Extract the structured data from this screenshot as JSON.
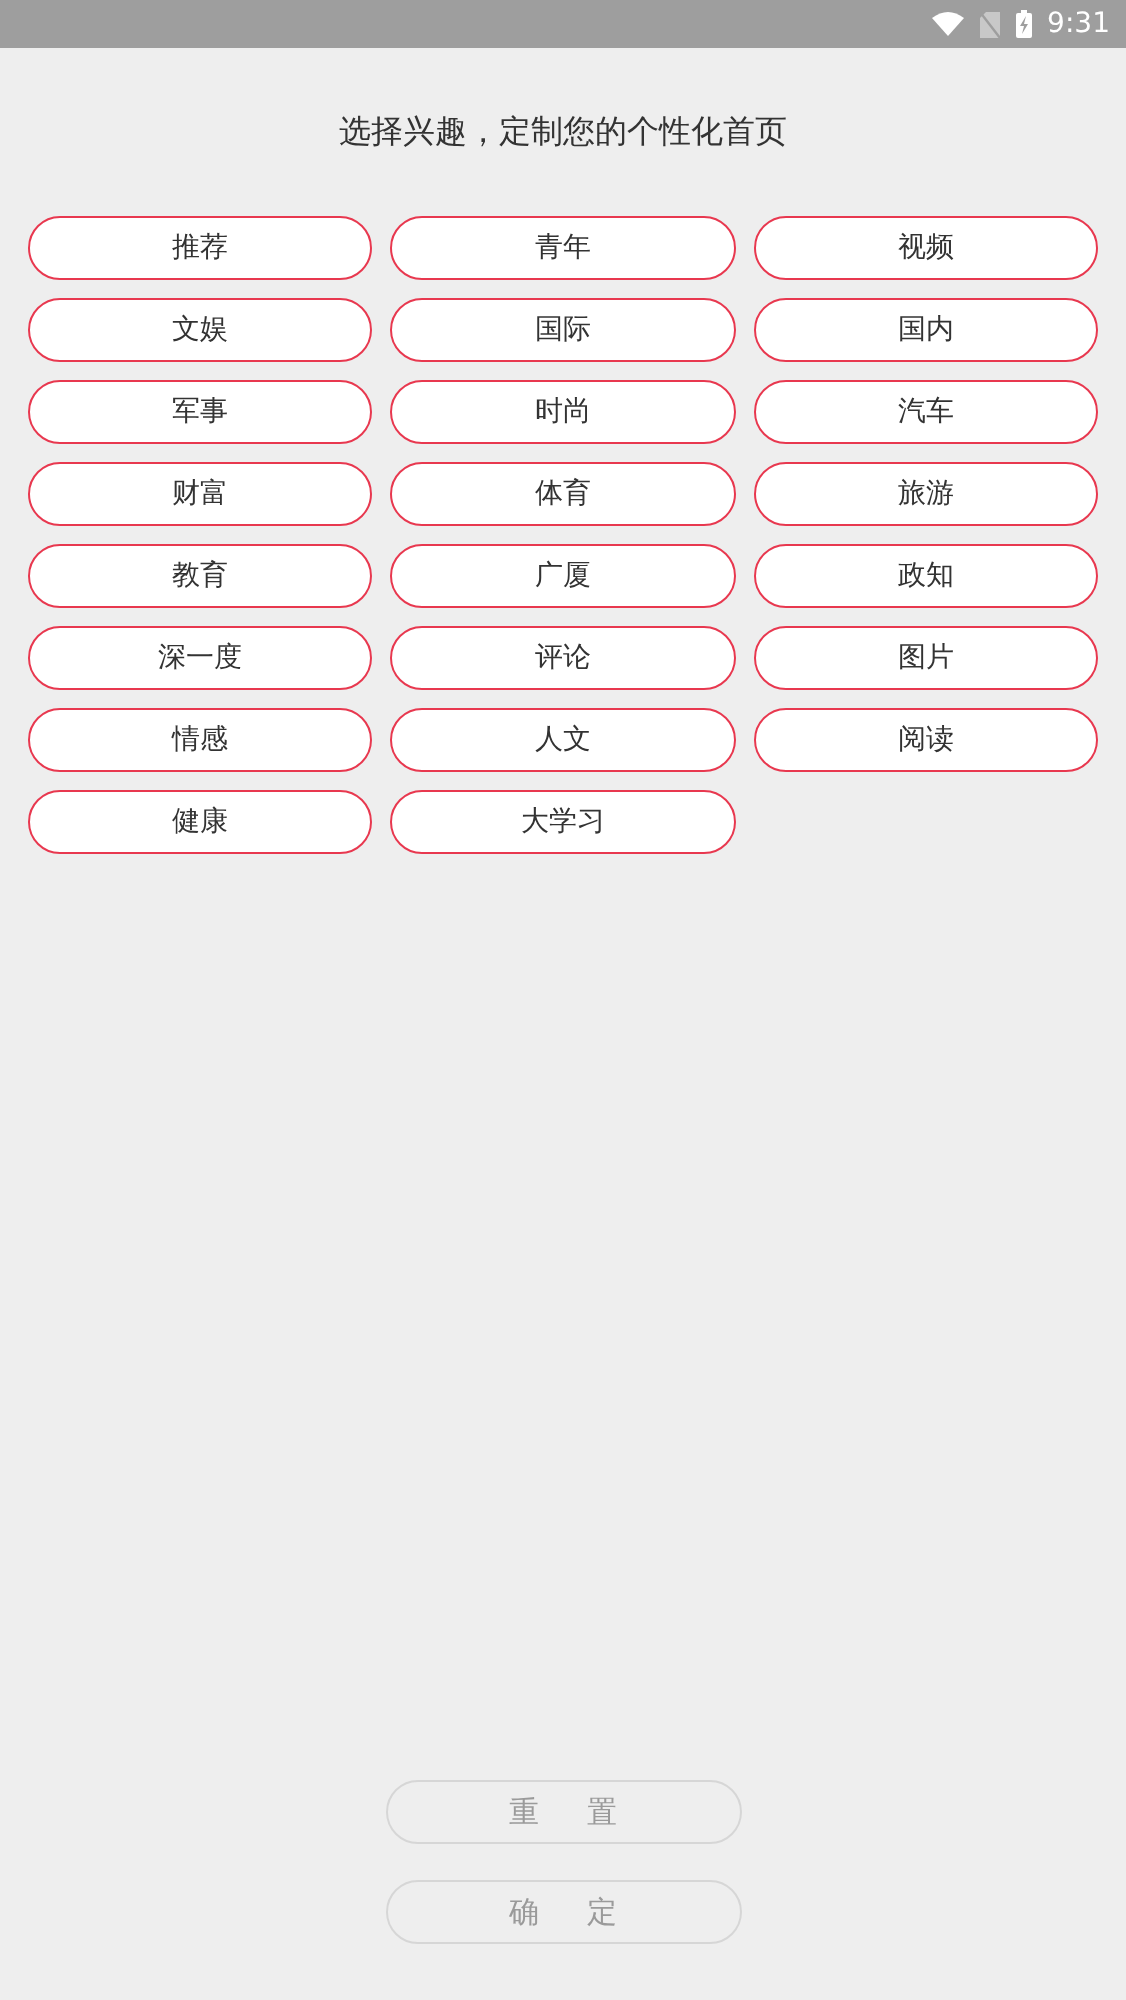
{
  "status_bar": {
    "time": "9:31"
  },
  "title": "选择兴趣，定制您的个性化首页",
  "topics": [
    {
      "label": "推荐",
      "selected": false
    },
    {
      "label": "青年",
      "selected": false
    },
    {
      "label": "视频",
      "selected": false
    },
    {
      "label": "文娱",
      "selected": false
    },
    {
      "label": "国际",
      "selected": false
    },
    {
      "label": "国内",
      "selected": false
    },
    {
      "label": "军事",
      "selected": false
    },
    {
      "label": "时尚",
      "selected": false
    },
    {
      "label": "汽车",
      "selected": false
    },
    {
      "label": "财富",
      "selected": false
    },
    {
      "label": "体育",
      "selected": false
    },
    {
      "label": "旅游",
      "selected": false
    },
    {
      "label": "教育",
      "selected": false
    },
    {
      "label": "广厦",
      "selected": false
    },
    {
      "label": "政知",
      "selected": false
    },
    {
      "label": "深一度",
      "selected": false
    },
    {
      "label": "评论",
      "selected": false
    },
    {
      "label": "图片",
      "selected": false
    },
    {
      "label": "情感",
      "selected": false
    },
    {
      "label": "人文",
      "selected": false
    },
    {
      "label": "阅读",
      "selected": false
    },
    {
      "label": "健康",
      "selected": false
    },
    {
      "label": "大学习",
      "selected": false
    }
  ],
  "buttons": [
    {
      "label": "重置",
      "disabled": true
    },
    {
      "label": "确定",
      "disabled": true
    }
  ]
}
